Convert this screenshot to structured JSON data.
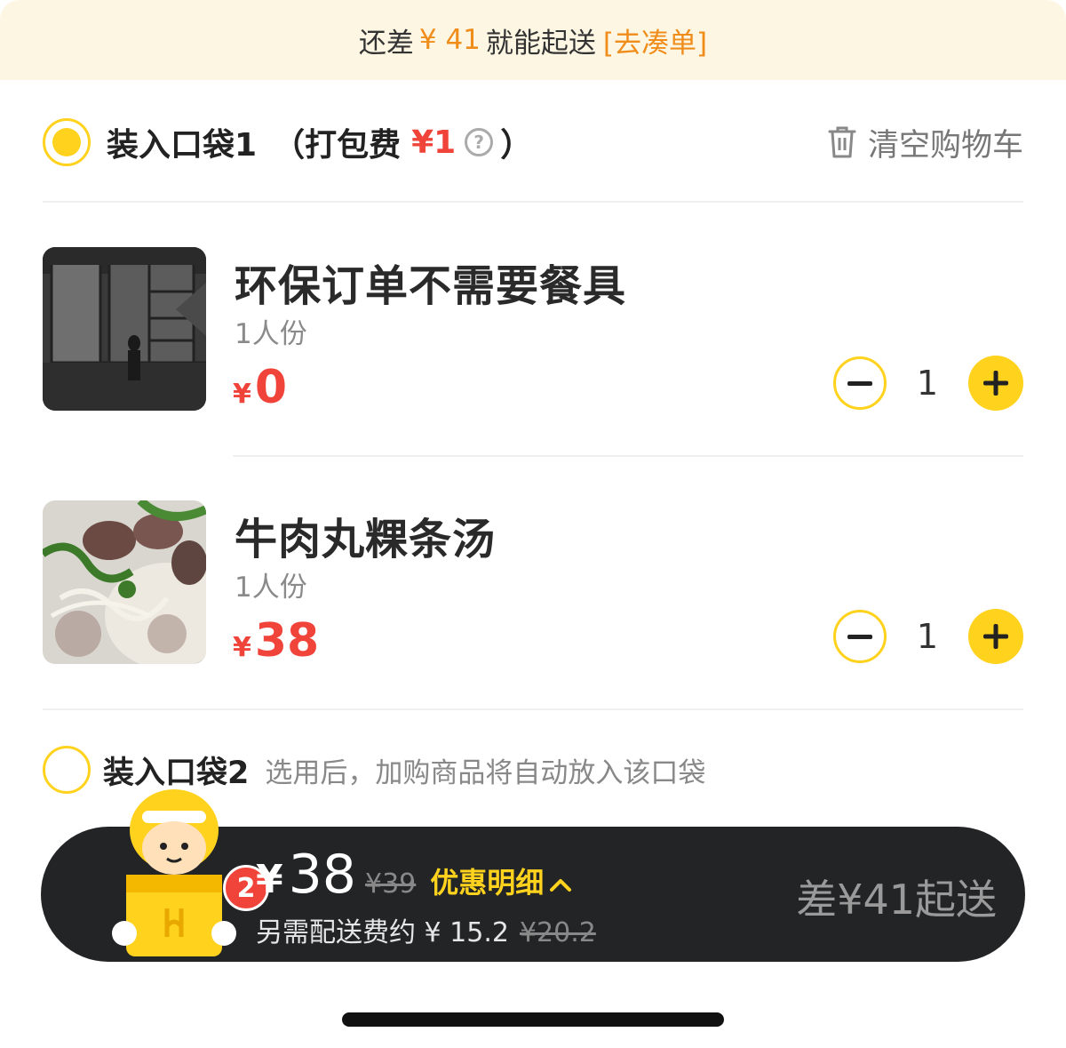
{
  "notice": {
    "prefix": "还差",
    "amount": "¥ 41",
    "suffix": "就能起送",
    "link": "[去凑单]"
  },
  "bag1": {
    "title": "装入口袋1",
    "fee_open": "（打包费",
    "fee_amount": "¥1",
    "fee_close": "）",
    "help_icon": "?",
    "clear_label": "清空购物车"
  },
  "items": [
    {
      "name": "环保订单不需要餐具",
      "spec": "1人份",
      "currency": "¥",
      "price": "0",
      "qty": "1",
      "thumb_icon": "window-scene-image"
    },
    {
      "name": "牛肉丸粿条汤",
      "spec": "1人份",
      "currency": "¥",
      "price": "38",
      "qty": "1",
      "thumb_icon": "beef-noodle-soup-image"
    }
  ],
  "bag2": {
    "title": "装入口袋2",
    "hint": "选用后，加购商品将自动放入该口袋"
  },
  "checkout": {
    "cart_count": "2",
    "currency": "¥",
    "total": "38",
    "original_total": "¥39",
    "discount_label": "优惠明细",
    "delivery_fee_label": "另需配送费约 ¥ 15.2",
    "delivery_fee_original": "¥20.2",
    "min_order_text": "差¥41起送"
  },
  "colors": {
    "accent_yellow": "#ffd21e",
    "price_red": "#f0443a",
    "notice_orange": "#f08c1a",
    "checkout_bg": "#222426"
  }
}
